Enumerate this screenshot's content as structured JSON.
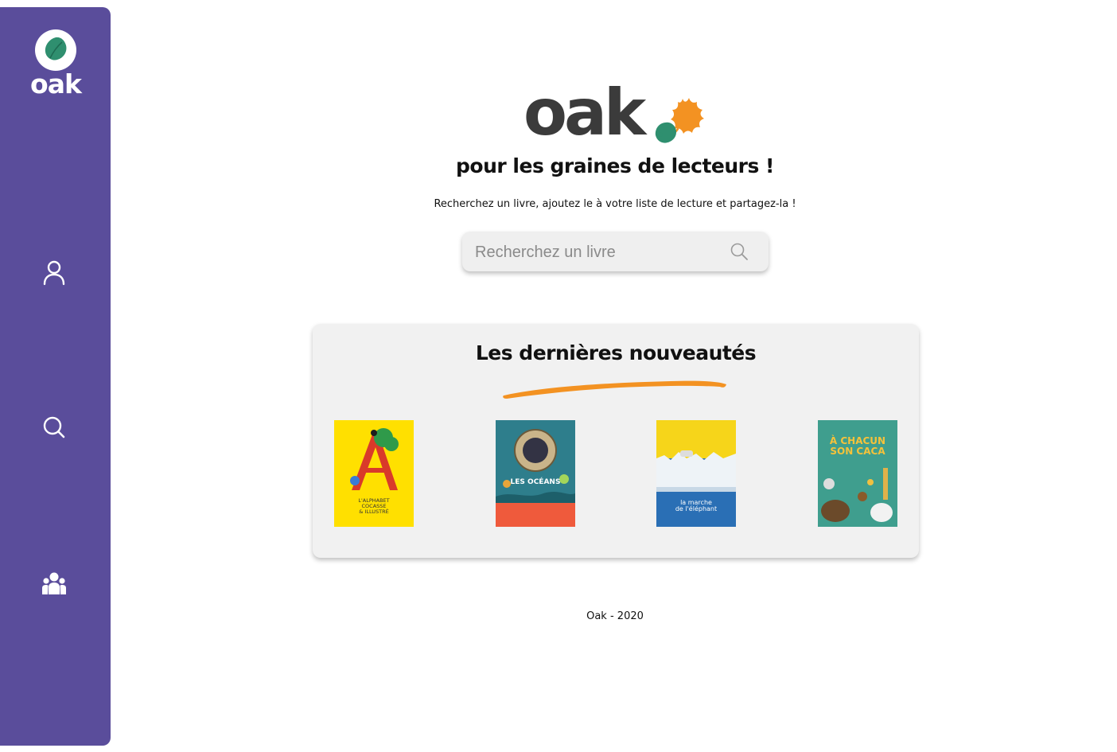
{
  "sidebar": {
    "logo_text": "oak",
    "nav": [
      {
        "icon": "user-icon"
      },
      {
        "icon": "search-icon"
      },
      {
        "icon": "group-icon"
      }
    ]
  },
  "hero": {
    "logo_text": "oak",
    "tagline": "pour les graines de lecteurs !",
    "subtitle": "Recherchez un livre, ajoutez le à votre liste de lecture et partagez-la !"
  },
  "search": {
    "placeholder": "Recherchez un livre",
    "value": ""
  },
  "news": {
    "title": "Les dernières nouveautés",
    "books": [
      {
        "cover_lines": [
          "L'ALPHABET",
          "COCASSE",
          "& ILLUSTRÉ"
        ],
        "cover_color": "#ffe000"
      },
      {
        "cover_lines": [
          "LES OCÉANS"
        ],
        "cover_color": "#2e7e8c"
      },
      {
        "cover_lines": [
          "la marche",
          "de l'éléphant"
        ],
        "cover_color": "#2a6fb5"
      },
      {
        "cover_lines": [
          "À CHACUN",
          "SON CACA"
        ],
        "cover_color": "#3f9e8e"
      }
    ]
  },
  "footer": {
    "text": "Oak - 2020"
  },
  "colors": {
    "sidebar": "#5a4d9b",
    "leaf_green": "#2f8f6f",
    "accent_orange": "#f39222"
  }
}
